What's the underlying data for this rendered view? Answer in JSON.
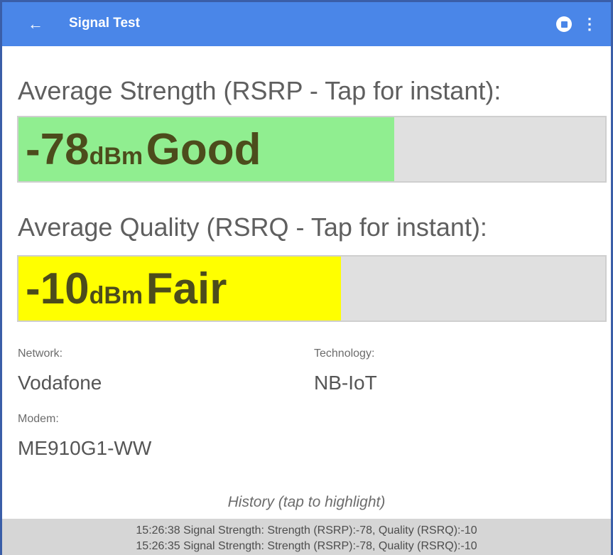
{
  "appbar": {
    "back_icon": "arrow-left-icon",
    "title": "Signal Test",
    "stop_icon": "stop-circle-icon",
    "more_icon": "more-vertical-icon"
  },
  "strength": {
    "heading": "Average Strength (RSRP - Tap for instant):",
    "value": "-78",
    "unit": "dBm",
    "rating": "Good",
    "fill_fraction": 0.64,
    "fill_color": "#90ee90"
  },
  "quality": {
    "heading": "Average Quality (RSRQ - Tap for instant):",
    "value": "-10",
    "unit": "dBm",
    "rating": "Fair",
    "fill_fraction": 0.55,
    "fill_color": "#ffff00"
  },
  "info": {
    "network_label": "Network:",
    "network_value": "Vodafone",
    "technology_label": "Technology:",
    "technology_value": "NB-IoT",
    "modem_label": "Modem:",
    "modem_value": "ME910G1-WW"
  },
  "history": {
    "title": "History (tap to highlight)",
    "rows": [
      "15:26:38 Signal Strength: Strength (RSRP):-78, Quality (RSRQ):-10",
      "15:26:35 Signal Strength: Strength (RSRP):-78, Quality (RSRQ):-10"
    ]
  },
  "colors": {
    "appbar": "#4a86e8",
    "frame": "#3a5ea8"
  }
}
